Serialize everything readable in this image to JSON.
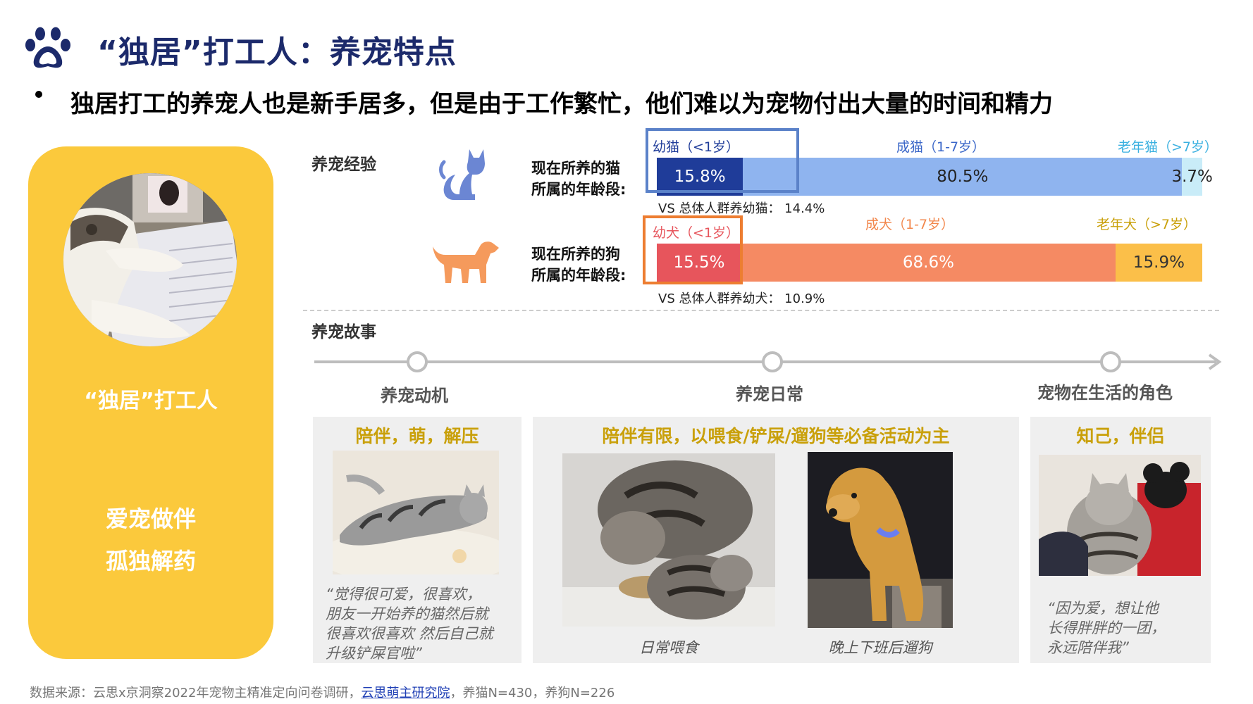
{
  "header": {
    "title": "“独居”打工人：养宠特点",
    "subtitle": "独居打工的养宠人也是新手居多，但是由于工作繁忙，他们难以为宠物付出大量的时间和精力"
  },
  "left_card": {
    "title": "“独居”打工人",
    "line1": "爱宠做伴",
    "line2": "孤独解药"
  },
  "experience": {
    "section_label": "养宠经验",
    "cat": {
      "row_label_1": "现在所养的猫",
      "row_label_2": "所属的年龄段:",
      "seg_labels": [
        "幼猫（<1岁）",
        "成猫（1-7岁）",
        "老年猫（>7岁）"
      ],
      "values": [
        "15.8%",
        "80.5%",
        "3.7%"
      ],
      "shares": [
        15.8,
        80.5,
        3.7
      ],
      "vs": "VS 总体人群养幼猫： 14.4%",
      "colors": [
        "#1f3c99",
        "#8fb4ef",
        "#c9ecf8"
      ]
    },
    "dog": {
      "row_label_1": "现在所养的狗",
      "row_label_2": "所属的年龄段:",
      "seg_labels": [
        "幼犬（<1岁）",
        "成犬（1-7岁）",
        "老年犬（>7岁）"
      ],
      "values": [
        "15.5%",
        "68.6%",
        "15.9%"
      ],
      "shares": [
        15.5,
        68.6,
        15.9
      ],
      "vs": "VS 总体人群养幼犬： 10.9%",
      "colors": [
        "#e7555c",
        "#f58a63",
        "#fbbf49"
      ]
    }
  },
  "story": {
    "section_label": "养宠故事",
    "stages": [
      "养宠动机",
      "养宠日常",
      "宠物在生活的角色"
    ],
    "motive": {
      "head": "陪伴，萌，解压",
      "quote": [
        "“觉得很可爱，很喜欢，",
        "朋友一开始养的猫然后就",
        "很喜欢很喜欢 然后自己就",
        "升级铲屎官啦”"
      ]
    },
    "daily": {
      "head": "陪伴有限，以喂食/铲屎/遛狗等必备活动为主",
      "caption_left": "日常喂食",
      "caption_right": "晚上下班后遛狗"
    },
    "role": {
      "head": "知己，伴侣",
      "quote": [
        "“因为爱，想让他",
        "长得胖胖的一团，",
        "永远陪伴我”"
      ]
    }
  },
  "source": {
    "prefix": "数据来源：云思x京洞察2022年宠物主精准定向问卷调研，",
    "link": "云思萌主研究院",
    "suffix": "，养猫N=430，养狗N=226"
  },
  "colors": {
    "title": "#1c2a6b",
    "card": "#fbc93c",
    "accent_gold": "#c9a00a",
    "cat_blue": "#5b82c9",
    "dog_orange": "#ed7d31"
  }
}
